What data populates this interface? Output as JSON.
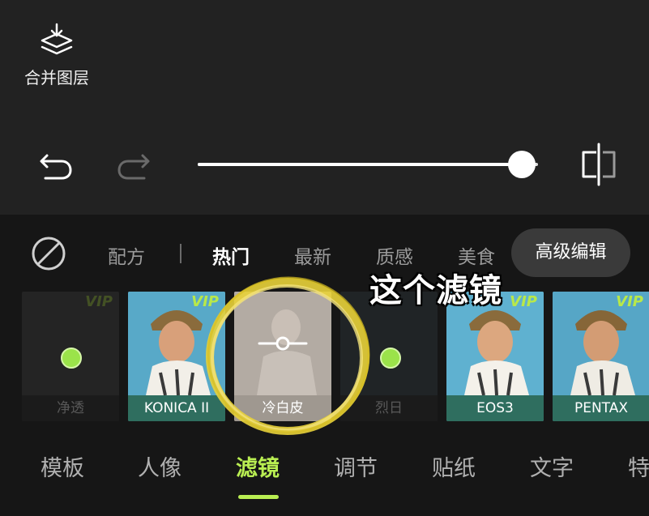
{
  "toolbar": {
    "merge_label": "合并图层",
    "slider": {
      "value": 1.0
    }
  },
  "filter_tabs": {
    "items": [
      "配方",
      "热门",
      "最新",
      "质感",
      "美食"
    ],
    "active": "热门",
    "advanced_button": "高级编辑"
  },
  "filters": [
    {
      "name": "净透",
      "vip": true,
      "state": "dim",
      "label_visible": "净透"
    },
    {
      "name": "KONICA II",
      "vip": true,
      "state": "normal"
    },
    {
      "name": "冷白皮",
      "vip": false,
      "state": "selected"
    },
    {
      "name": "烈日",
      "vip": false,
      "state": "dim"
    },
    {
      "name": "EOS3",
      "vip": true,
      "state": "normal"
    },
    {
      "name": "PENTAX",
      "vip": true,
      "state": "normal"
    }
  ],
  "vip_badge": "VIP",
  "annotation": "这个滤镜",
  "bottom_nav": {
    "items": [
      "模板",
      "人像",
      "滤镜",
      "调节",
      "贴纸",
      "文字",
      "特"
    ],
    "active": "滤镜"
  },
  "colors": {
    "accent": "#b9ee52",
    "annotation_ring": "#e8d23a"
  }
}
